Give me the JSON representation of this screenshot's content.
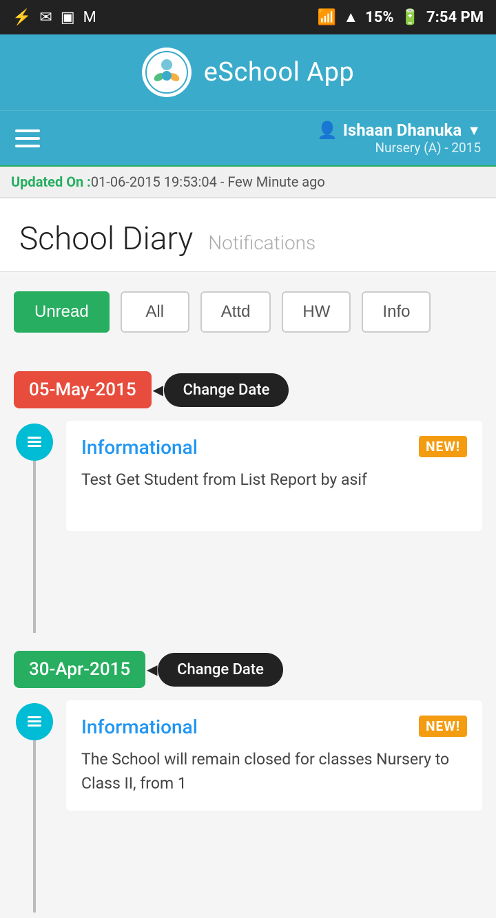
{
  "status_bar": {
    "time": "7:54 PM",
    "battery": "15%"
  },
  "app_header": {
    "title": "eSchool App"
  },
  "nav_bar": {
    "user_name": "Ishaan Dhanuka",
    "user_class": "Nursery (A) - 2015"
  },
  "update_banner": {
    "label": "Updated On :",
    "text": " 01-06-2015 19:53:04 - Few Minute ago"
  },
  "page": {
    "title": "School Diary",
    "subtitle": "Notifications"
  },
  "filters": [
    {
      "id": "unread",
      "label": "Unread",
      "active": true
    },
    {
      "id": "all",
      "label": "All",
      "active": false
    },
    {
      "id": "attd",
      "label": "Attd",
      "active": false
    },
    {
      "id": "hw",
      "label": "HW",
      "active": false
    },
    {
      "id": "info",
      "label": "Info",
      "active": false
    }
  ],
  "entries": [
    {
      "date": "05-May-2015",
      "date_color": "red",
      "change_date_label": "Change Date",
      "type": "Informational",
      "is_new": true,
      "new_label": "NEW!",
      "text": "Test Get Student from List Report by asif"
    },
    {
      "date": "30-Apr-2015",
      "date_color": "green",
      "change_date_label": "Change Date",
      "type": "Informational",
      "is_new": true,
      "new_label": "NEW!",
      "text": "The School will remain closed for classes Nursery to Class II, from 1"
    }
  ]
}
